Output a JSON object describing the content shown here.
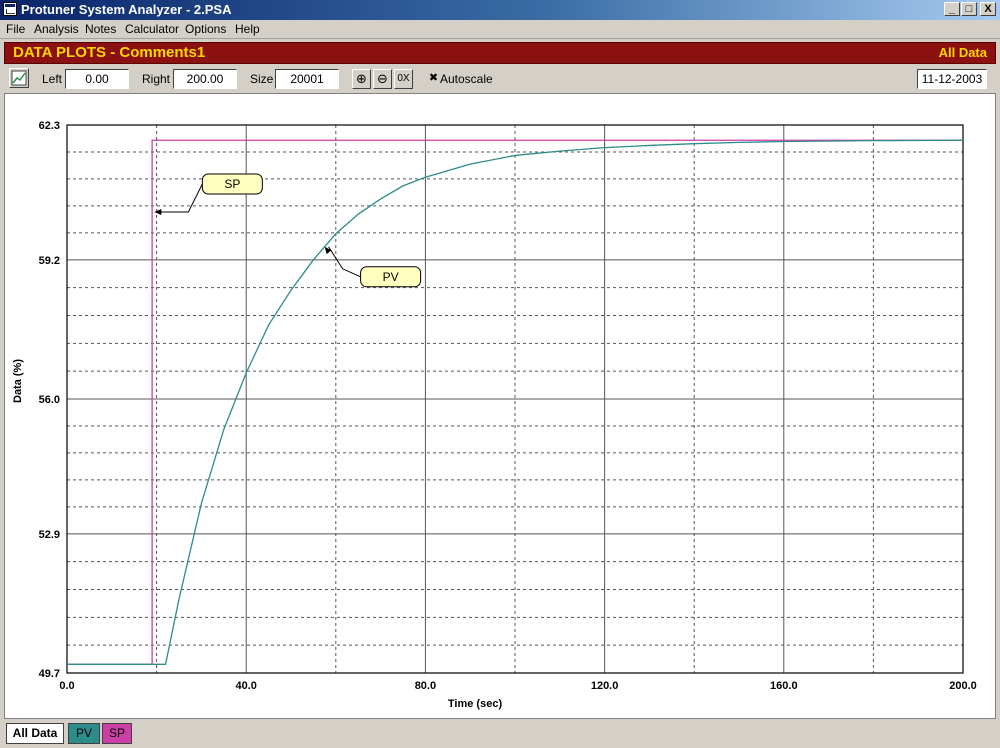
{
  "window": {
    "title": "Protuner System Analyzer - 2.PSA",
    "controls": [
      "_",
      "□",
      "X"
    ]
  },
  "menu": [
    "File",
    "Analysis",
    "Notes",
    "Calculator",
    "Options",
    "Help"
  ],
  "header": {
    "title": "DATA PLOTS - Comments1",
    "right_label": "All Data"
  },
  "toolbar": {
    "left_label": "Left",
    "left_value": "0.00",
    "right_label": "Right",
    "right_value": "200.00",
    "size_label": "Size",
    "size_value": "20001",
    "zoom_in": "⊕",
    "zoom_out": "⊖",
    "zoom_reset": "0X",
    "autoscale_label": "Autoscale",
    "autoscale_checked": "✖",
    "date": "11-12-2003"
  },
  "chart_data": {
    "type": "line",
    "xlabel": "Time (sec)",
    "ylabel": "Data (%)",
    "xlim": [
      0,
      200
    ],
    "ylim": [
      49.7,
      62.3
    ],
    "xticks": [
      0,
      40,
      80,
      120,
      160,
      200
    ],
    "xtick_labels": [
      "0.0",
      "40.0",
      "80.0",
      "120.0",
      "160.0",
      "200.0"
    ],
    "yticks": [
      49.7,
      52.9,
      56.0,
      59.2,
      62.3
    ],
    "ytick_labels": [
      "49.7",
      "52.9",
      "56.0",
      "59.2",
      "62.3"
    ],
    "grid": true,
    "series": [
      {
        "name": "SP",
        "color": "#cc3fa6",
        "x": [
          0,
          19,
          19,
          200
        ],
        "y": [
          49.9,
          49.9,
          61.95,
          61.95
        ]
      },
      {
        "name": "PV",
        "color": "#2e8b8b",
        "x": [
          0,
          22,
          25,
          30,
          35,
          40,
          45,
          50,
          55,
          60,
          65,
          70,
          75,
          80,
          90,
          100,
          110,
          120,
          130,
          140,
          150,
          160,
          180,
          200
        ],
        "y": [
          49.9,
          49.9,
          51.4,
          53.6,
          55.3,
          56.6,
          57.7,
          58.5,
          59.2,
          59.8,
          60.25,
          60.6,
          60.9,
          61.1,
          61.4,
          61.6,
          61.7,
          61.78,
          61.83,
          61.87,
          61.9,
          61.92,
          61.94,
          61.95
        ]
      }
    ],
    "annotations": [
      {
        "text": "SP",
        "target_x": 19.5,
        "target_y": 60.3
      },
      {
        "text": "PV",
        "target_x": 57.5,
        "target_y": 59.5
      }
    ]
  },
  "tabs": [
    {
      "label": "All Data",
      "bg": "#ffffff",
      "fg": "#000000"
    },
    {
      "label": "PV",
      "bg": "#2e8b8b",
      "fg": "#000000"
    },
    {
      "label": "SP",
      "bg": "#cc3fa6",
      "fg": "#000000"
    }
  ]
}
